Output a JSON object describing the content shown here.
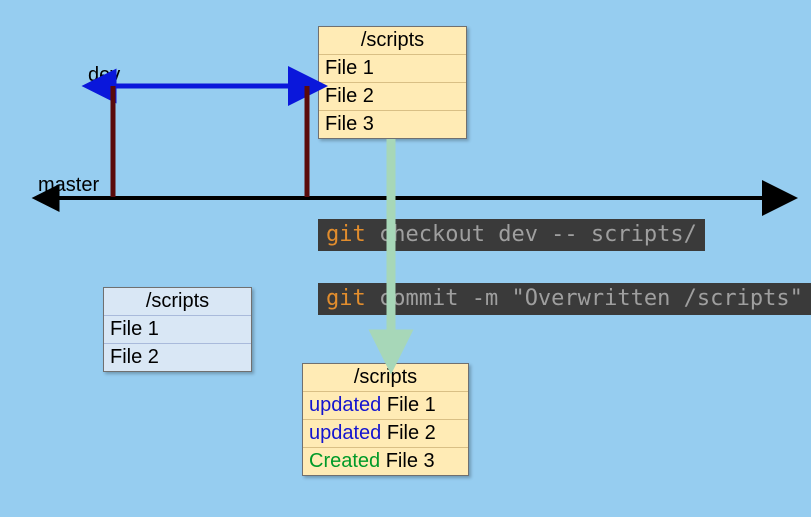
{
  "branches": {
    "dev_label": "dev",
    "master_label": "master"
  },
  "folders": {
    "dev_header": "/scripts",
    "dev_files": {
      "f1": "File 1",
      "f2": "File 2",
      "f3": "File 3"
    },
    "master_header": "/scripts",
    "master_files": {
      "f1": "File 1",
      "f2": "File 2"
    },
    "result_header": "/scripts",
    "result_files": {
      "f1_status": "updated",
      "f1_name": "File 1",
      "f2_status": "updated",
      "f2_name": "File 2",
      "f3_status": "Created",
      "f3_name": "File 3"
    }
  },
  "commands": {
    "git_keyword": "git",
    "checkout_rest": " checkout dev -- scripts/",
    "commit_rest": " commit -m \"Overwritten /scripts\""
  }
}
